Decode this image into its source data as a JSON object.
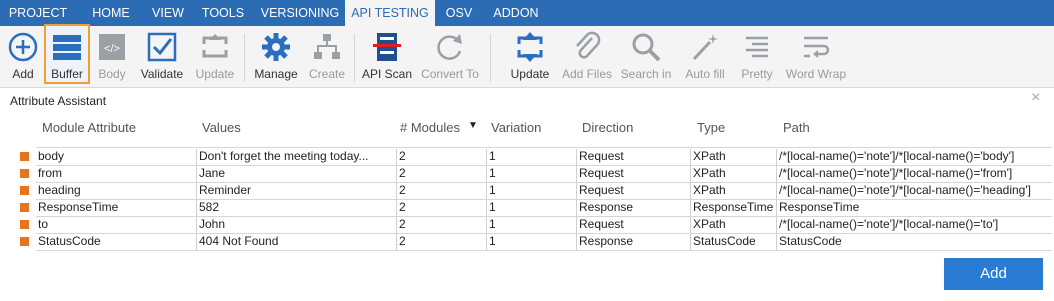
{
  "menu": {
    "tabs": [
      "PROJECT",
      "HOME",
      "VIEW",
      "TOOLS",
      "VERSIONING",
      "API TESTING",
      "OSV",
      "ADDON"
    ],
    "active": "API TESTING"
  },
  "ribbon": {
    "buttons": [
      {
        "label": "Add",
        "icon": "plus-circle-icon"
      },
      {
        "label": "Buffer",
        "icon": "buffer-stack-icon"
      },
      {
        "label": "Body",
        "icon": "code-brackets-icon"
      },
      {
        "label": "Validate",
        "icon": "checkbox-icon"
      },
      {
        "label": "Update",
        "icon": "update-arrows-icon"
      },
      {
        "label": "Manage",
        "icon": "gear-icon"
      },
      {
        "label": "Create",
        "icon": "network-icon"
      },
      {
        "label": "API Scan",
        "icon": "api-scan-icon"
      },
      {
        "label": "Convert To",
        "icon": "refresh-arrow-icon"
      },
      {
        "label": "Update",
        "icon": "update-arrows-icon"
      },
      {
        "label": "Add Files",
        "icon": "paperclip-icon"
      },
      {
        "label": "Search in",
        "icon": "search-icon"
      },
      {
        "label": "Auto fill",
        "icon": "magic-wand-icon"
      },
      {
        "label": "Pretty",
        "icon": "align-lines-icon"
      },
      {
        "label": "Word Wrap",
        "icon": "word-wrap-icon"
      }
    ]
  },
  "panel": {
    "title": "Attribute Assistant",
    "close": "×"
  },
  "grid": {
    "headers": [
      "Module Attribute",
      "Values",
      "# Modules",
      "Variation",
      "Direction",
      "Type",
      "Path"
    ],
    "rows": [
      [
        "body",
        "Don't forget the meeting today...",
        "2",
        "1",
        "Request",
        "XPath",
        "/*[local-name()='note']/*[local-name()='body']"
      ],
      [
        "from",
        "Jane",
        "2",
        "1",
        "Request",
        "XPath",
        "/*[local-name()='note']/*[local-name()='from']"
      ],
      [
        "heading",
        "Reminder",
        "2",
        "1",
        "Request",
        "XPath",
        "/*[local-name()='note']/*[local-name()='heading']"
      ],
      [
        "ResponseTime",
        "582",
        "2",
        "1",
        "Response",
        "ResponseTime",
        "ResponseTime"
      ],
      [
        "to",
        "John",
        "2",
        "1",
        "Request",
        "XPath",
        "/*[local-name()='note']/*[local-name()='to']"
      ],
      [
        "StatusCode",
        "404 Not Found",
        "2",
        "1",
        "Response",
        "StatusCode",
        "StatusCode"
      ]
    ]
  },
  "footer": {
    "add_label": "Add"
  },
  "colors": {
    "menu_bg": "#2b6cb4",
    "accent": "#2a7bd4",
    "row_marker": "#e8731d",
    "selected_border": "#f0a030"
  }
}
